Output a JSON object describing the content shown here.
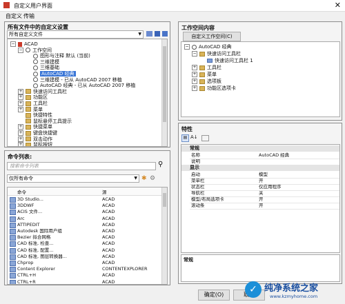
{
  "window": {
    "title": "自定义用户界面"
  },
  "menu_tabs": [
    "自定义",
    "传输"
  ],
  "left_top": {
    "header": "所有文件中的自定义设置",
    "dropdown_value": "所有自定义文件",
    "tree": [
      {
        "label": "ACAD",
        "indent": 0,
        "toggle": "−",
        "icon": "cad-file-icon"
      },
      {
        "label": "工作空间",
        "indent": 1,
        "toggle": "−",
        "icon": "gear-icon"
      },
      {
        "label": "图形与注释 默认 (当前)",
        "indent": 2,
        "toggle": "",
        "icon": "gear-icon"
      },
      {
        "label": "三维建模",
        "indent": 2,
        "toggle": "",
        "icon": "gear-icon"
      },
      {
        "label": "三维基础",
        "indent": 2,
        "toggle": "",
        "icon": "gear-icon"
      },
      {
        "label": "AutoCAD 经典",
        "indent": 2,
        "toggle": "",
        "icon": "gear-icon",
        "selected": true
      },
      {
        "label": "三维建模 - 已从 AutoCAD 2007 移植",
        "indent": 2,
        "toggle": "",
        "icon": "gear-icon"
      },
      {
        "label": "AutoCAD 经典 - 已从 AutoCAD 2007 移植",
        "indent": 2,
        "toggle": "",
        "icon": "gear-icon"
      },
      {
        "label": "快速访问工具栏",
        "indent": 1,
        "toggle": "+",
        "icon": "folder-icon"
      },
      {
        "label": "功能区",
        "indent": 1,
        "toggle": "+",
        "icon": "folder-icon"
      },
      {
        "label": "工具栏",
        "indent": 1,
        "toggle": "+",
        "icon": "folder-icon"
      },
      {
        "label": "菜单",
        "indent": 1,
        "toggle": "+",
        "icon": "folder-icon"
      },
      {
        "label": "快捷特性",
        "indent": 1,
        "toggle": "",
        "icon": "folder-icon"
      },
      {
        "label": "鼠标悬停工具提示",
        "indent": 1,
        "toggle": "",
        "icon": "folder-icon"
      },
      {
        "label": "快捷菜单",
        "indent": 1,
        "toggle": "+",
        "icon": "folder-icon"
      },
      {
        "label": "键盘快捷键",
        "indent": 1,
        "toggle": "+",
        "icon": "folder-icon"
      },
      {
        "label": "双击动作",
        "indent": 1,
        "toggle": "+",
        "icon": "folder-icon"
      },
      {
        "label": "鼠标按钮",
        "indent": 1,
        "toggle": "+",
        "icon": "folder-icon"
      }
    ]
  },
  "left_bottom": {
    "header": "命令列表:",
    "search_placeholder": "搜索命令列表",
    "filter_value": "仅所有命令",
    "columns": [
      "命令",
      "源"
    ],
    "commands": [
      {
        "name": "3D Studio...",
        "source": "ACAD"
      },
      {
        "name": "3DDWF",
        "source": "ACAD"
      },
      {
        "name": "ACIS 文件...",
        "source": "ACAD"
      },
      {
        "name": "Arc",
        "source": "ACAD"
      },
      {
        "name": "ATTIPEDIT",
        "source": "ACAD"
      },
      {
        "name": "Autodesk 国际用户组",
        "source": "ACAD"
      },
      {
        "name": "Bezier 拟合网格",
        "source": "ACAD"
      },
      {
        "name": "CAD 标准, 检查...",
        "source": "ACAD"
      },
      {
        "name": "CAD 标准, 配置...",
        "source": "ACAD"
      },
      {
        "name": "CAD 标准, 图层转换器...",
        "source": "ACAD"
      },
      {
        "name": "Chprop",
        "source": "ACAD"
      },
      {
        "name": "Content Explorer",
        "source": "CONTENTEXPLORER"
      },
      {
        "name": "CTRL+H",
        "source": "ACAD"
      },
      {
        "name": "CTRL+R",
        "source": "ACAD"
      }
    ]
  },
  "right_top": {
    "header": "工作空间内容",
    "button": "自定义工作空间(C)",
    "tree": [
      {
        "label": "AutoCAD 经典",
        "indent": 0,
        "toggle": "−",
        "icon": "gear-icon"
      },
      {
        "label": "快速访问工具栏",
        "indent": 1,
        "toggle": "−",
        "icon": "folder-icon"
      },
      {
        "label": "快速访问工具栏 1",
        "indent": 2,
        "toggle": "",
        "icon": "toolbar-icon"
      },
      {
        "label": "工具栏",
        "indent": 1,
        "toggle": "+",
        "icon": "folder-icon"
      },
      {
        "label": "菜单",
        "indent": 1,
        "toggle": "+",
        "icon": "folder-icon"
      },
      {
        "label": "选项板",
        "indent": 1,
        "toggle": "+",
        "icon": "folder-icon"
      },
      {
        "label": "功能区选项卡",
        "indent": 1,
        "toggle": "+",
        "icon": "folder-icon"
      }
    ]
  },
  "properties": {
    "header": "特性",
    "sections": [
      {
        "title": "常规",
        "rows": [
          {
            "key": "名称",
            "value": "AutoCAD 经典"
          },
          {
            "key": "说明",
            "value": ""
          }
        ]
      },
      {
        "title": "显示",
        "rows": [
          {
            "key": "启动",
            "value": "模型"
          },
          {
            "key": "菜单栏",
            "value": "开"
          },
          {
            "key": "状态栏",
            "value": "仅应用程序"
          },
          {
            "key": "导航栏",
            "value": "关"
          },
          {
            "key": "模型/布局选项卡",
            "value": "开"
          },
          {
            "key": "滚动条",
            "value": "开"
          }
        ]
      }
    ],
    "description_title": "常规"
  },
  "footer": {
    "ok": "确定(O)",
    "cancel": "取消"
  },
  "watermark": {
    "brand": "纯净系统之家",
    "url": "www.kzmyhome.com"
  }
}
